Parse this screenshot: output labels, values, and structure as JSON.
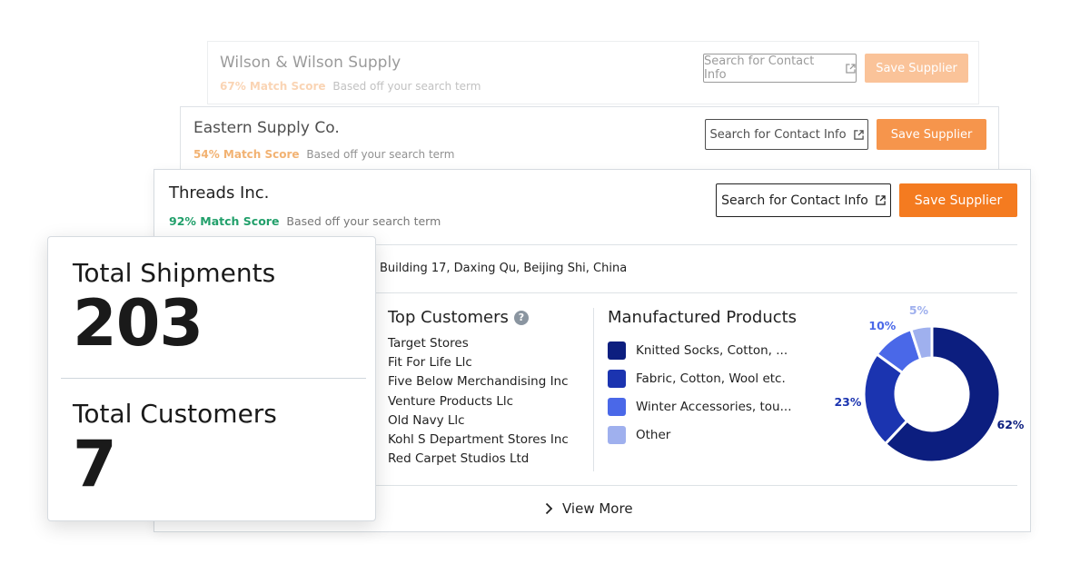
{
  "suppliers": [
    {
      "name": "Wilson & Wilson Supply",
      "match_pct": "67% Match Score",
      "match_note": "Based off your search term",
      "contact_label": "Search for Contact Info",
      "save_label": "Save Supplier",
      "match_color": "#f4a25a"
    },
    {
      "name": "Eastern Supply Co.",
      "match_pct": "54% Match Score",
      "match_note": "Based off your search term",
      "contact_label": "Search for Contact Info",
      "save_label": "Save Supplier",
      "match_color": "#f0a050"
    },
    {
      "name": "Threads Inc.",
      "match_pct": "92% Match Score",
      "match_note": "Based off your search term",
      "contact_label": "Search for Contact Info",
      "save_label": "Save Supplier",
      "match_color": "#22a06b",
      "address": "Building 17, Daxing Qu, Beijing Shi, China",
      "top_customers_title": "Top Customers",
      "top_customers": [
        "Target Stores",
        "Fit For Life Llc",
        "Five Below Merchandising Inc",
        "Venture Products Llc",
        "Old Navy Llc",
        "Kohl S Department Stores Inc",
        "Red Carpet Studios Ltd"
      ],
      "products_title": "Manufactured Products",
      "view_more_label": "View More"
    }
  ],
  "stats": {
    "shipments_label": "Total Shipments",
    "shipments_value": "203",
    "customers_label": "Total Customers",
    "customers_value": "7"
  },
  "colors": {
    "accent_orange": "#f47b20",
    "match_green": "#22a06b"
  },
  "chart_data": {
    "type": "pie",
    "donut": true,
    "categories": [
      "Knitted Socks, Cotton, ...",
      "Fabric, Cotton, Wool etc.",
      "Winter Accessories, tou...",
      "Other"
    ],
    "values": [
      62,
      23,
      10,
      5
    ],
    "value_labels": [
      "62%",
      "23%",
      "10%",
      "5%"
    ],
    "colors": [
      "#0c1e7f",
      "#1b34b0",
      "#4a68e8",
      "#9fb0ee"
    ],
    "legend_position": "left"
  }
}
